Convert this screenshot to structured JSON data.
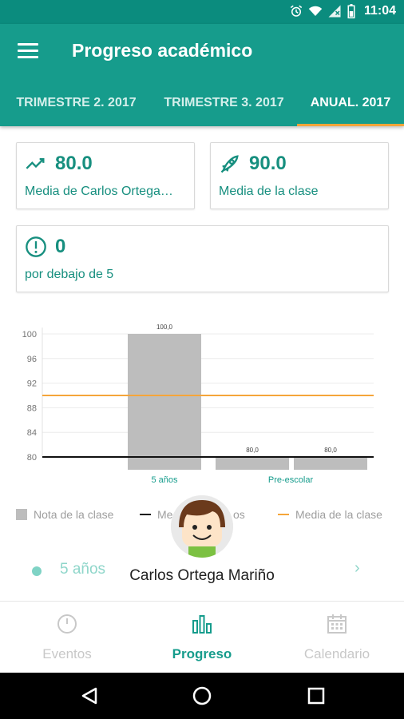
{
  "status": {
    "time": "11:04"
  },
  "app": {
    "title": "Progreso académico"
  },
  "tabs": [
    {
      "label": "TRIMESTRE 2. 2017",
      "active": false
    },
    {
      "label": "TRIMESTRE 3. 2017",
      "active": false
    },
    {
      "label": "ANUAL. 2017",
      "active": true
    }
  ],
  "cards": {
    "student_avg": {
      "value": "80.0",
      "label": "Media de Carlos Ortega…",
      "icon": "trending-up-icon"
    },
    "class_avg": {
      "value": "90.0",
      "label": "Media de la clase",
      "icon": "rocket-icon"
    },
    "below": {
      "value": "0",
      "label": "por debajo de 5",
      "icon": "alert-circle-icon"
    }
  },
  "chart_data": {
    "type": "bar",
    "categories": [
      "5 años",
      "Pre-escolar"
    ],
    "bars": [
      {
        "category": "5 años",
        "value": 100.0,
        "label": "100,0"
      },
      {
        "category": "Pre-escolar",
        "value": 80.0,
        "label": "80,0"
      },
      {
        "category": "Pre-escolar",
        "value": 80.0,
        "label": "80,0"
      }
    ],
    "yticks": [
      "100",
      "96",
      "92",
      "88",
      "84",
      "80"
    ],
    "ylim": [
      80,
      100
    ],
    "reference_lines": [
      {
        "name": "Media de la clase",
        "value": 90.0,
        "color": "#f5a53a"
      },
      {
        "name": "Media del alumno",
        "value": 80.0,
        "color": "#111111"
      }
    ],
    "grid": true,
    "legend_position": "bottom"
  },
  "legend": {
    "items": [
      {
        "label": "Nota de la clase",
        "color": "#bdbdbd"
      },
      {
        "label": "Me",
        "label_right": "os",
        "color": "#111111"
      },
      {
        "label": "Media de la clase",
        "color": "#f5a53a"
      }
    ]
  },
  "student": {
    "name": "Carlos Ortega Mariño"
  },
  "subject": {
    "label": "5 años"
  },
  "bottom_nav": [
    {
      "label": "Eventos",
      "active": false,
      "icon": "clock-icon"
    },
    {
      "label": "Progreso",
      "active": true,
      "icon": "bar-chart-icon"
    },
    {
      "label": "Calendario",
      "active": false,
      "icon": "calendar-icon"
    }
  ],
  "colors": {
    "primary": "#169c8c",
    "status_bar": "#0b8c7e",
    "accent": "#f5a53a",
    "bar_gray": "#bdbdbd"
  }
}
